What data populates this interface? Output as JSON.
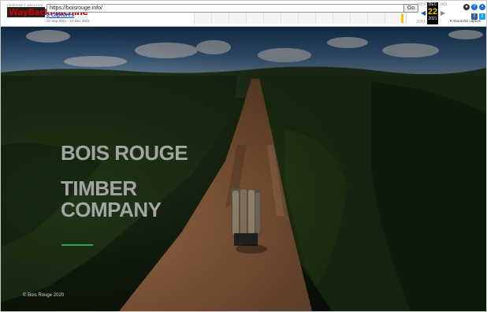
{
  "wayback": {
    "logo_small": "INTERNET ARCHIVE",
    "logo_main": "WayBackMachine",
    "url": "https://boisrouge.info/",
    "go_label": "Go",
    "captures": "2 captures",
    "range": "22 Sep 2021 - 22 Dec 2021",
    "cal_prev_month": "NOV",
    "cal_month": "DEC",
    "cal_day": "22",
    "cal_year": "2021",
    "cal_next_month": "JAN",
    "cal_prev_year": "2020",
    "about": "About this capture",
    "icons": [
      "user-icon",
      "help-icon",
      "close-icon",
      "facebook-icon",
      "twitter-icon"
    ]
  },
  "hero": {
    "line1": "BOIS ROUGE",
    "line2": "TIMBER",
    "line3": "COMPANY",
    "copyright": "© Bois Rouge 2020"
  },
  "colors": {
    "accent": "#3f9f5a",
    "headline": "#a4a4a4",
    "wayback_highlight": "#f5c500"
  }
}
